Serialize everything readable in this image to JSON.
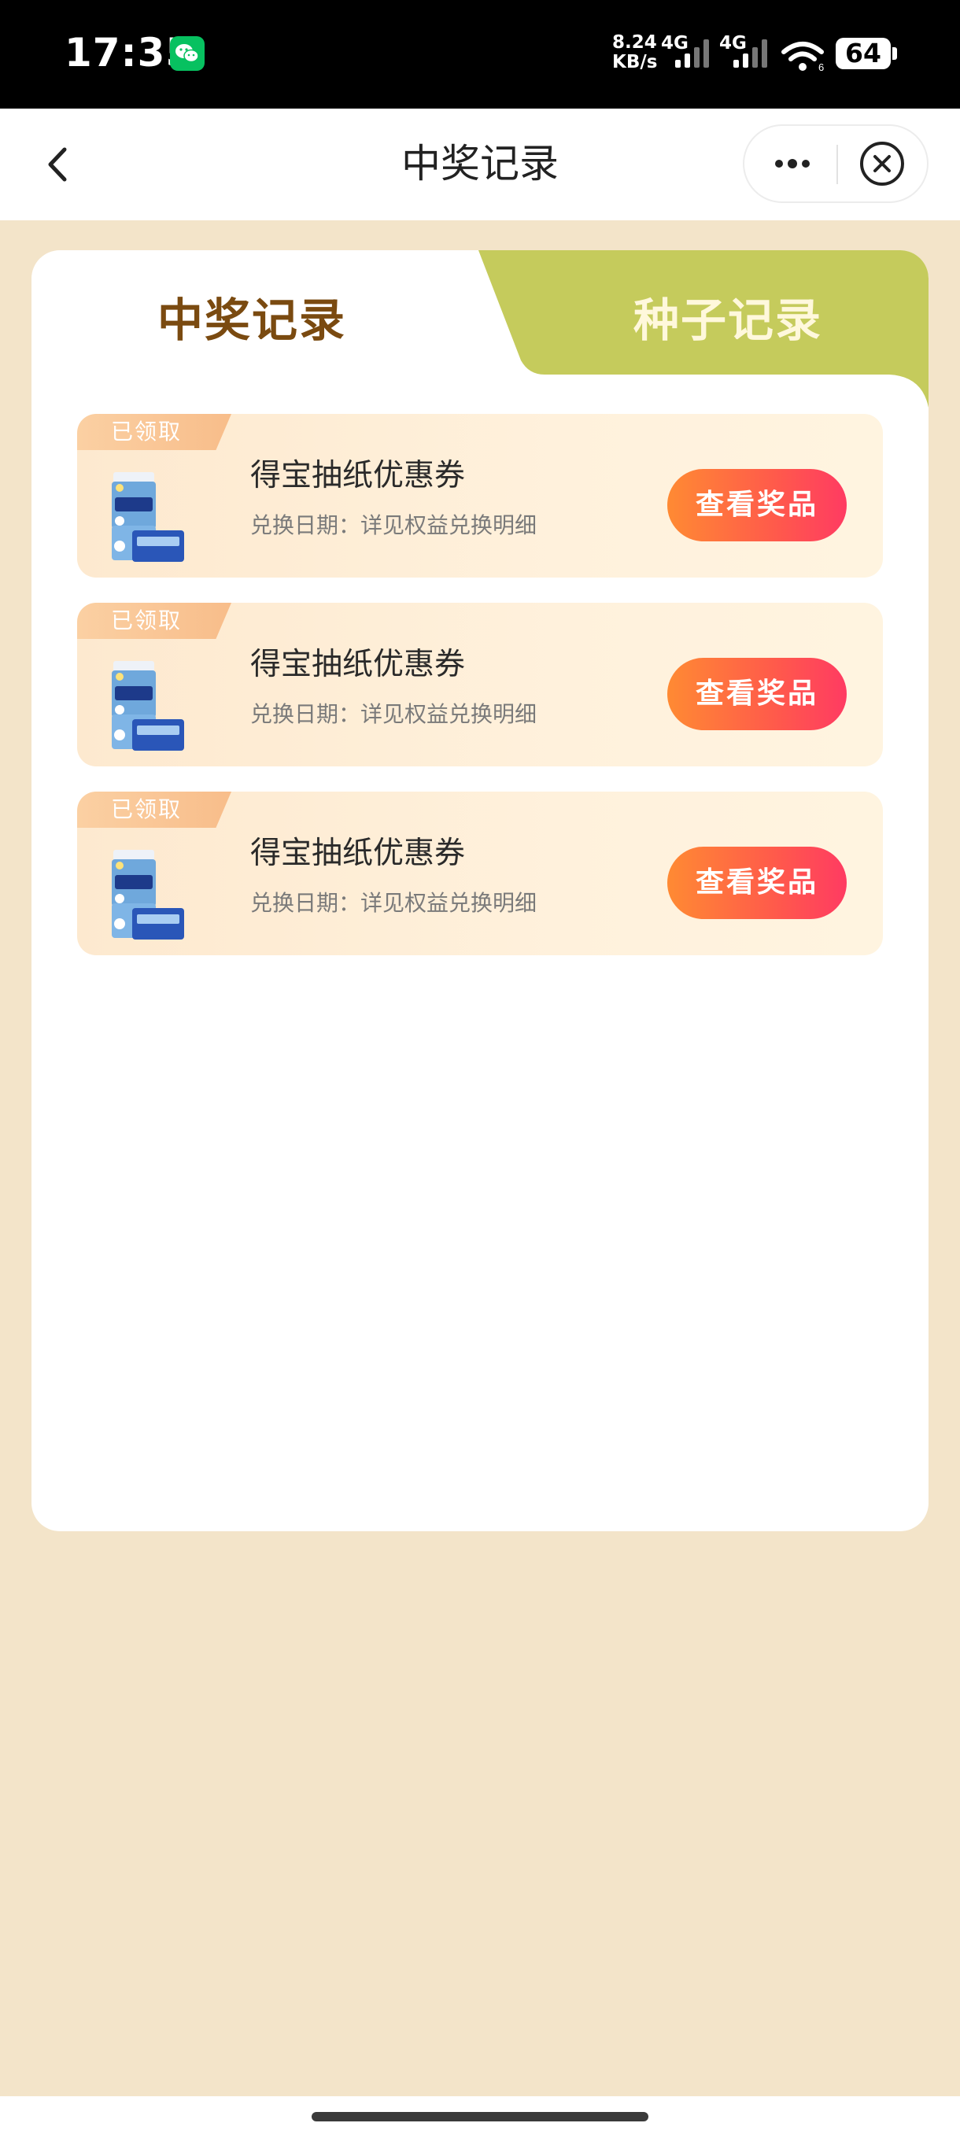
{
  "status_bar": {
    "time": "17:35",
    "app_icon": "wechat-icon",
    "net_speed_value": "8.24",
    "net_speed_unit": "KB/s",
    "network_1": "4G",
    "network_2": "4G",
    "battery": "64"
  },
  "nav": {
    "title": "中奖记录",
    "back_icon": "chevron-left-icon",
    "more_icon": "more-dots-icon",
    "close_icon": "close-circle-icon"
  },
  "tabs": [
    {
      "label": "中奖记录",
      "active": true
    },
    {
      "label": "种子记录",
      "active": false
    }
  ],
  "colors": {
    "page_bg": "#f3e4c9",
    "tab_inactive_bg": "#c5cb5c",
    "tab_active_text": "#7a4a10",
    "button_gradient_start": "#ff8a33",
    "button_gradient_end": "#ff3b62"
  },
  "records": [
    {
      "badge": "已领取",
      "title": "得宝抽纸优惠券",
      "subtitle": "兑换日期：详见权益兑换明细",
      "button": "查看奖品"
    },
    {
      "badge": "已领取",
      "title": "得宝抽纸优惠券",
      "subtitle": "兑换日期：详见权益兑换明细",
      "button": "查看奖品"
    },
    {
      "badge": "已领取",
      "title": "得宝抽纸优惠券",
      "subtitle": "兑换日期：详见权益兑换明细",
      "button": "查看奖品"
    }
  ]
}
